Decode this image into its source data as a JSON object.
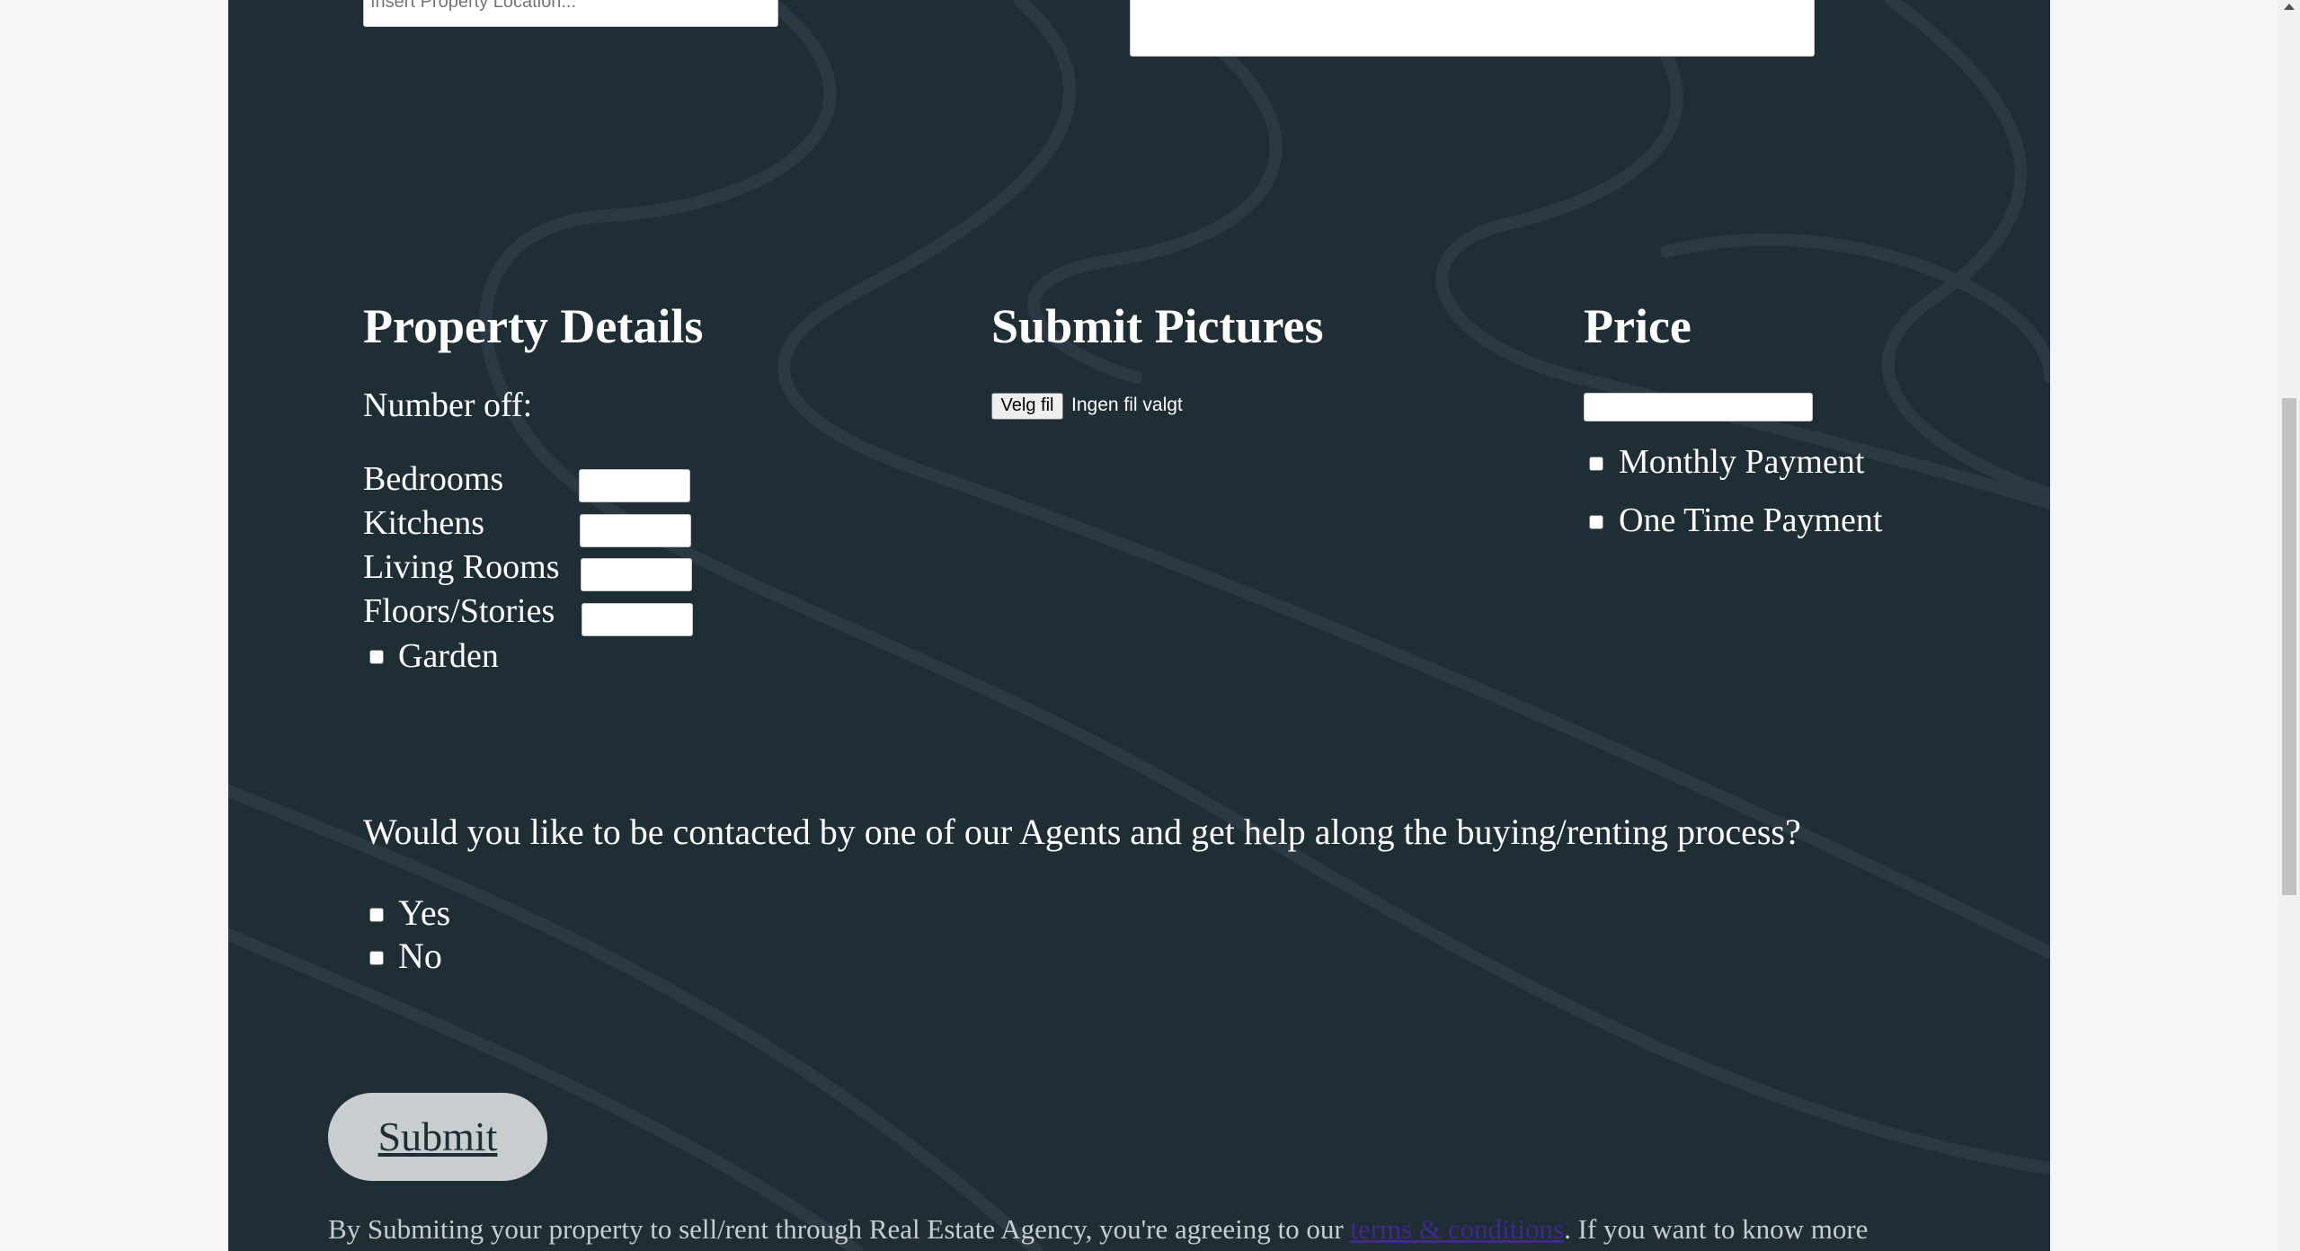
{
  "location": {
    "placeholder": "Insert Property Location..."
  },
  "property_details": {
    "heading": "Property Details",
    "number_of_label": "Number off:",
    "rows": [
      {
        "label": "Bedrooms"
      },
      {
        "label": "Kitchens"
      },
      {
        "label": "Living Rooms"
      },
      {
        "label": "Floors/Stories"
      }
    ],
    "garden_label": "Garden"
  },
  "pictures": {
    "heading": "Submit Pictures",
    "choose_file_label": "Velg fil",
    "no_file_label": "Ingen fil valgt"
  },
  "price": {
    "heading": "Price",
    "options": [
      "Monthly Payment",
      "One Time Payment"
    ]
  },
  "contact": {
    "question": "Would you like to be contacted by one of our Agents and get help along the buying/renting process?",
    "options": [
      "Yes",
      "No"
    ]
  },
  "submit": {
    "label": "Submit"
  },
  "footer": {
    "text_before": "By Submiting your property to sell/rent through Real Estate Agency, you're agreeing to our ",
    "link_text": "terms & conditions",
    "text_after": ". If you want to know more"
  },
  "colors": {
    "page_bg": "#1f2d35",
    "outer_bg": "#f6f6f6",
    "submit_bg": "#c8cdd0",
    "link": "#3f2a8c"
  },
  "icons": {
    "scroll_up": "triangle-up"
  }
}
